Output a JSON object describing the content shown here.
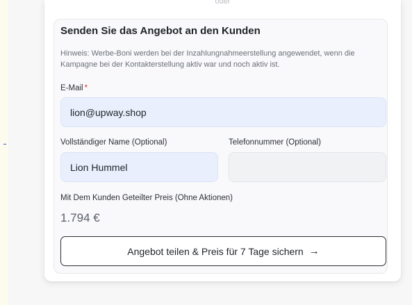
{
  "divider": {
    "text": "oder"
  },
  "form": {
    "title": "Senden Sie das Angebot an den Kunden",
    "hint": "Hinweis: Werbe-Boni werden bei der Inzahlungnahmeerstellung angewendet, wenn die Kampagne bei der Kontakterstellung aktiv war und noch aktiv ist.",
    "email": {
      "label": "E-Mail",
      "required_mark": "*",
      "value": "lion@upway.shop"
    },
    "full_name": {
      "label": "Vollständiger Name (Optional)",
      "value": "Lion Hummel"
    },
    "phone": {
      "label": "Telefonnummer (Optional)",
      "value": ""
    },
    "price": {
      "label": "Mit Dem Kunden Geteilter Preis (Ohne Aktionen)",
      "value": "1.794 €"
    },
    "share_button": {
      "label": "Angebot teilen & Preis für 7 Tage sichern",
      "icon": "arrow-right-icon",
      "arrow": "→"
    }
  }
}
